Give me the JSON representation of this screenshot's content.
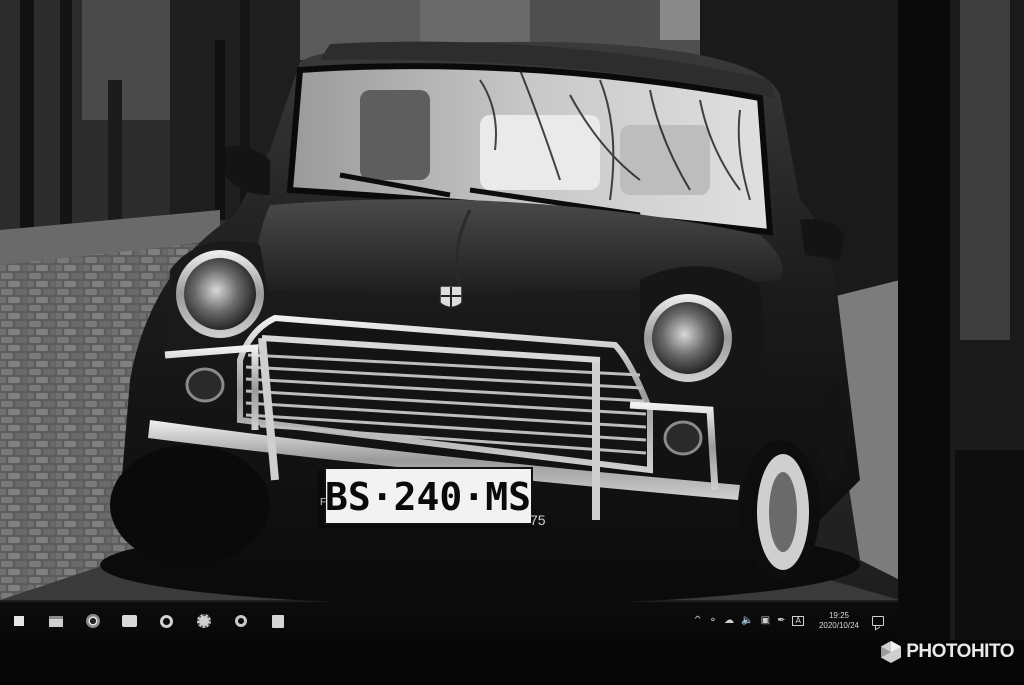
{
  "photo": {
    "subject": "classic-mini-car",
    "plate_text": "BS·240·MS",
    "plate_country": "F",
    "plate_department": "75",
    "tone": "monochrome"
  },
  "taskbar": {
    "pinned_icons": [
      "windows-start-icon",
      "file-explorer-icon",
      "chrome-icon",
      "folder-icon",
      "settings-icon",
      "photos-icon",
      "media-icon",
      "app-icon"
    ],
    "tray": {
      "chevron": "^",
      "network_icon": "network-icon",
      "cloud_icon": "cloud-icon",
      "volume_icon": "volume-icon",
      "display_icon": "display-icon",
      "pen_icon": "pen-icon",
      "ime_label": "A",
      "time": "19:25",
      "date": "2020/10/24"
    }
  },
  "watermark": {
    "text_left": "PHOTO",
    "text_right": "HITO"
  },
  "colors": {
    "background": "#050505",
    "taskbar": "#0a0a0a",
    "watermark": "#e9e9e9"
  }
}
